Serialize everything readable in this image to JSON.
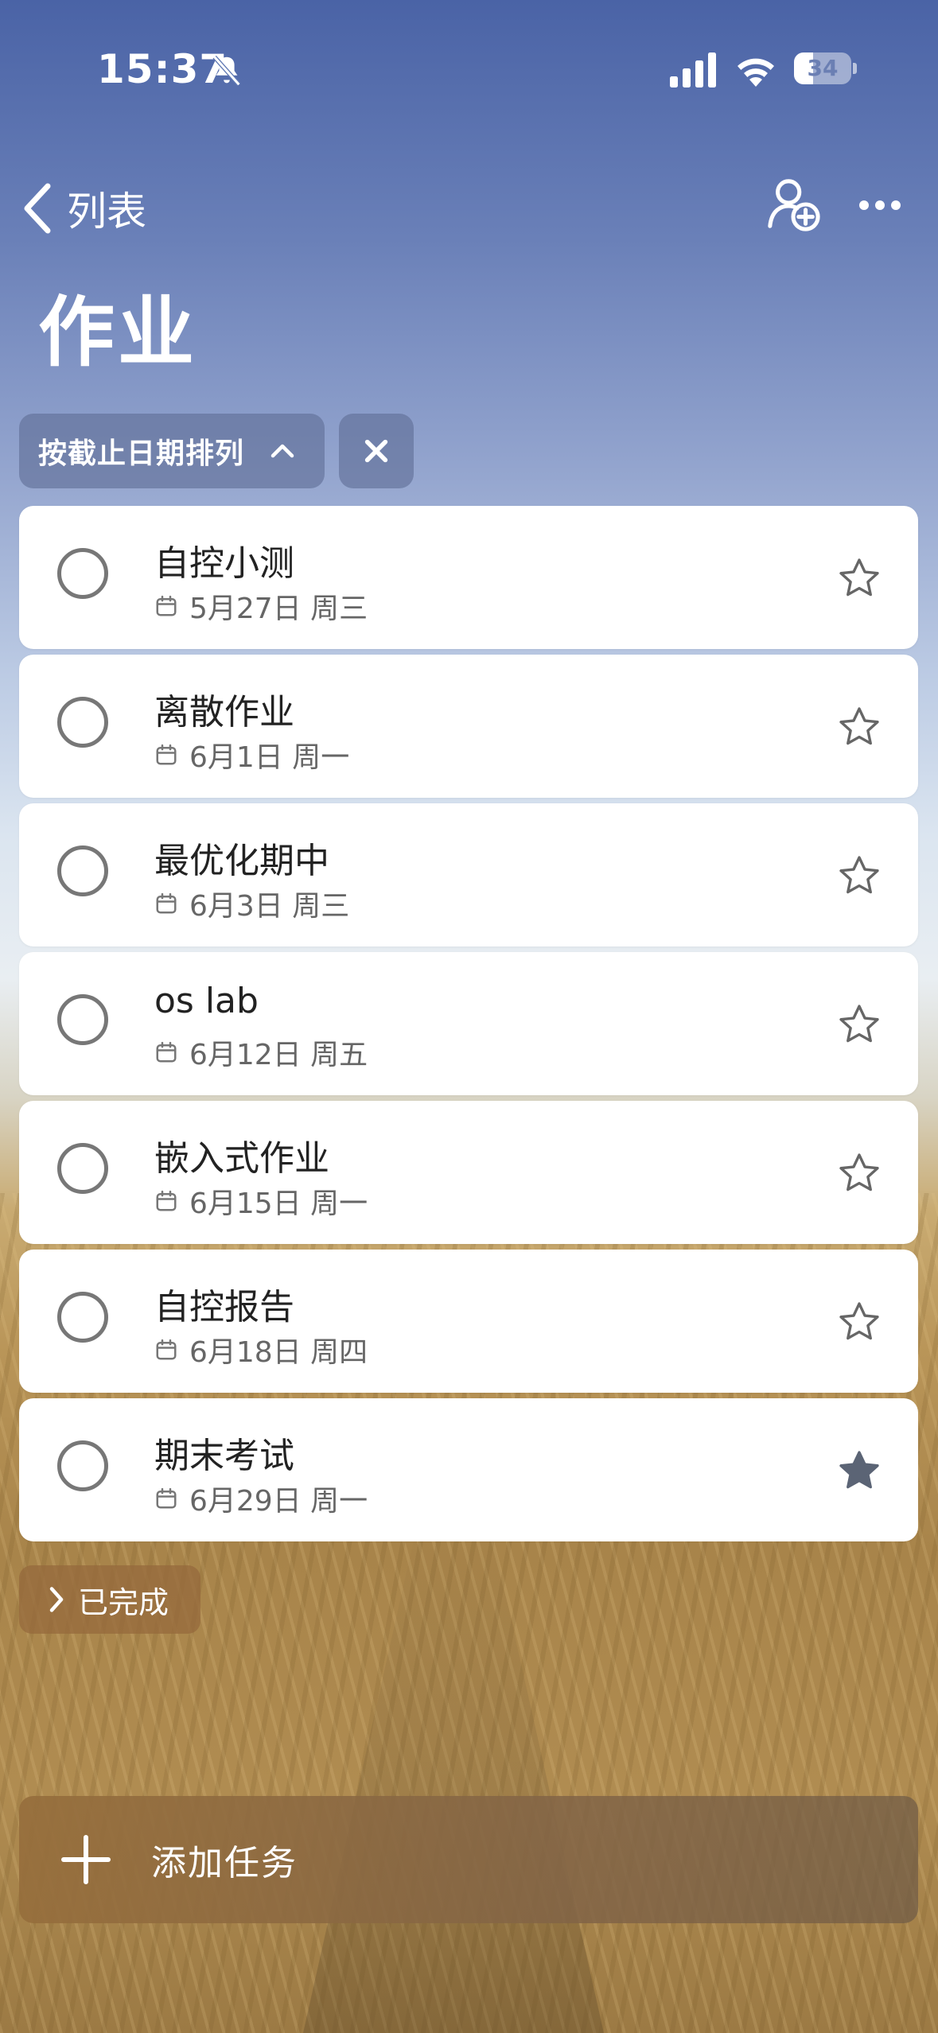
{
  "status_bar": {
    "time": "15:37",
    "battery": "34",
    "battery_level": 0.34,
    "icons": [
      "bell-slash-icon",
      "cellular-signal-icon",
      "wifi-icon",
      "battery-icon"
    ]
  },
  "nav": {
    "back_label": "列表",
    "title": "作业",
    "icons": [
      "chevron-left-icon",
      "add-person-icon",
      "more-icon"
    ]
  },
  "sort": {
    "label": "按截止日期排列",
    "icons": [
      "chevron-up-icon",
      "close-icon"
    ]
  },
  "tasks": [
    {
      "title": "自控小测",
      "date": "5月27日 周三",
      "starred": false
    },
    {
      "title": "离散作业",
      "date": "6月1日 周一",
      "starred": false
    },
    {
      "title": "最优化期中",
      "date": "6月3日 周三",
      "starred": false
    },
    {
      "title": "os lab",
      "date": "6月12日 周五",
      "starred": false
    },
    {
      "title": "嵌入式作业",
      "date": "6月15日 周一",
      "starred": false
    },
    {
      "title": "自控报告",
      "date": "6月18日 周四",
      "starred": false
    },
    {
      "title": "期末考试",
      "date": "6月29日 周一",
      "starred": true
    }
  ],
  "completed": {
    "label": "已完成"
  },
  "add_task": {
    "label": "添加任务"
  },
  "colors": {
    "accent_chip": "#5f6e96",
    "star_filled": "#5b6475",
    "star_outline": "#666666",
    "add_task_bg": "#96693c"
  }
}
